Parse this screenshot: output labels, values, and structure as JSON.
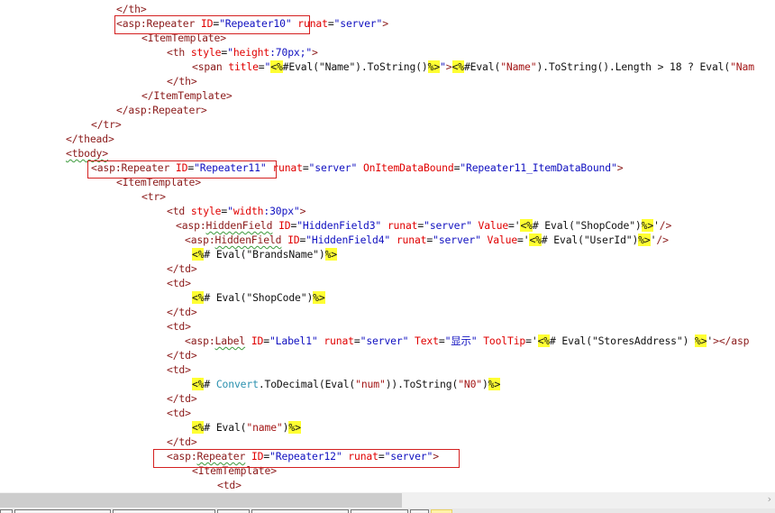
{
  "editor": {
    "lines": [
      [
        [
          "t",
          "</th>"
        ]
      ],
      [
        [
          "t",
          "<asp:Repeater "
        ],
        [
          "a",
          "ID"
        ],
        [
          "c",
          "="
        ],
        [
          "v",
          "\"Repeater10\""
        ],
        [
          "c",
          " "
        ],
        [
          "a",
          "runat"
        ],
        [
          "c",
          "="
        ],
        [
          "v",
          "\"server\""
        ],
        [
          "t",
          ">"
        ]
      ],
      [
        [
          "t",
          "<ItemTemplate>"
        ]
      ],
      [
        [
          "t",
          "<th "
        ],
        [
          "a",
          "style"
        ],
        [
          "c",
          "="
        ],
        [
          "v",
          "\""
        ],
        [
          "a",
          "height"
        ],
        [
          "v",
          ":70px;\""
        ],
        [
          "t",
          ">"
        ]
      ],
      [
        [
          "t",
          "<span "
        ],
        [
          "a",
          "title"
        ],
        [
          "c",
          "="
        ],
        [
          "v",
          "\""
        ],
        [
          "h",
          "<%"
        ],
        [
          "c",
          "#Eval(\"Name\").ToString()"
        ],
        [
          "h",
          "%>"
        ],
        [
          "v",
          "\""
        ],
        [
          "t",
          ">"
        ],
        [
          "h",
          "<%"
        ],
        [
          "c",
          "#Eval("
        ],
        [
          "s",
          "\"Name\""
        ],
        [
          "c",
          ").ToString().Length > 18 ? Eval("
        ],
        [
          "s",
          "\"Nam"
        ]
      ],
      [
        [
          "t",
          "</th>"
        ]
      ],
      [
        [
          "t",
          "</ItemTemplate>"
        ]
      ],
      [
        [
          "t",
          "</asp:Repeater>"
        ]
      ],
      [
        [
          "t",
          "</tr>"
        ]
      ],
      [
        [
          "t",
          "</thead>"
        ]
      ],
      [
        [
          "sq",
          "<tbody>"
        ]
      ],
      [
        [
          "t",
          "<asp:Repeater "
        ],
        [
          "a",
          "ID"
        ],
        [
          "c",
          "="
        ],
        [
          "v",
          "\"Repeater11\""
        ],
        [
          "c",
          " "
        ],
        [
          "a",
          "runat"
        ],
        [
          "c",
          "="
        ],
        [
          "v",
          "\"server\""
        ],
        [
          "c",
          " "
        ],
        [
          "a",
          "OnItemDataBound"
        ],
        [
          "c",
          "="
        ],
        [
          "v",
          "\"Repeater11_ItemDataBound\""
        ],
        [
          "t",
          ">"
        ]
      ],
      [
        [
          "t",
          "<ItemTemplate>"
        ]
      ],
      [
        [
          "t",
          "<tr>"
        ]
      ],
      [
        [
          "t",
          "<td "
        ],
        [
          "a",
          "style"
        ],
        [
          "c",
          "="
        ],
        [
          "v",
          "\""
        ],
        [
          "a",
          "width"
        ],
        [
          "v",
          ":30px\""
        ],
        [
          "t",
          ">"
        ]
      ],
      [
        [
          "t",
          "<asp:"
        ],
        [
          "sq",
          "HiddenField"
        ],
        [
          "t",
          " "
        ],
        [
          "a",
          "ID"
        ],
        [
          "c",
          "="
        ],
        [
          "v",
          "\"HiddenField3\""
        ],
        [
          "c",
          " "
        ],
        [
          "a",
          "runat"
        ],
        [
          "c",
          "="
        ],
        [
          "v",
          "\"server\""
        ],
        [
          "c",
          " "
        ],
        [
          "a",
          "Value"
        ],
        [
          "c",
          "='"
        ],
        [
          "h",
          "<%"
        ],
        [
          "c",
          "# Eval(\"ShopCode\")"
        ],
        [
          "h",
          "%>"
        ],
        [
          "c",
          "'"
        ],
        [
          "t",
          "/>"
        ]
      ],
      [
        [
          "t",
          "<asp:"
        ],
        [
          "sq",
          "HiddenField"
        ],
        [
          "t",
          " "
        ],
        [
          "a",
          "ID"
        ],
        [
          "c",
          "="
        ],
        [
          "v",
          "\"HiddenField4\""
        ],
        [
          "c",
          " "
        ],
        [
          "a",
          "runat"
        ],
        [
          "c",
          "="
        ],
        [
          "v",
          "\"server\""
        ],
        [
          "c",
          " "
        ],
        [
          "a",
          "Value"
        ],
        [
          "c",
          "='"
        ],
        [
          "h",
          "<%"
        ],
        [
          "c",
          "# Eval(\"UserId\")"
        ],
        [
          "h",
          "%>"
        ],
        [
          "c",
          "'"
        ],
        [
          "t",
          "/>"
        ]
      ],
      [
        [
          "h",
          "<%"
        ],
        [
          "c",
          "# Eval(\"BrandsName\")"
        ],
        [
          "h",
          "%>"
        ]
      ],
      [
        [
          "t",
          "</td>"
        ]
      ],
      [
        [
          "t",
          "<td>"
        ]
      ],
      [
        [
          "h",
          "<%"
        ],
        [
          "c",
          "# Eval(\"ShopCode\")"
        ],
        [
          "h",
          "%>"
        ]
      ],
      [
        [
          "t",
          "</td>"
        ]
      ],
      [
        [
          "t",
          "<td>"
        ]
      ],
      [
        [
          "t",
          "<asp:"
        ],
        [
          "sq",
          "Label"
        ],
        [
          "t",
          " "
        ],
        [
          "a",
          "ID"
        ],
        [
          "c",
          "="
        ],
        [
          "v",
          "\"Label1\""
        ],
        [
          "c",
          " "
        ],
        [
          "a",
          "runat"
        ],
        [
          "c",
          "="
        ],
        [
          "v",
          "\"server\""
        ],
        [
          "c",
          " "
        ],
        [
          "a",
          "Text"
        ],
        [
          "c",
          "="
        ],
        [
          "v",
          "\"显示\""
        ],
        [
          "c",
          " "
        ],
        [
          "a",
          "ToolTip"
        ],
        [
          "c",
          "='"
        ],
        [
          "h",
          "<%"
        ],
        [
          "c",
          "# Eval(\"StoresAddress\") "
        ],
        [
          "h",
          "%>"
        ],
        [
          "c",
          "'"
        ],
        [
          "t",
          "></asp"
        ]
      ],
      [
        [
          "t",
          "</td>"
        ]
      ],
      [
        [
          "t",
          "<td>"
        ]
      ],
      [
        [
          "h",
          "<%"
        ],
        [
          "c",
          "# "
        ],
        [
          "k",
          "Convert"
        ],
        [
          "c",
          ".ToDecimal(Eval("
        ],
        [
          "s",
          "\"num\""
        ],
        [
          "c",
          ")).ToString("
        ],
        [
          "s",
          "\"N0\""
        ],
        [
          "c",
          ")"
        ],
        [
          "h",
          "%>"
        ]
      ],
      [
        [
          "t",
          "</td>"
        ]
      ],
      [
        [
          "t",
          "<td>"
        ]
      ],
      [
        [
          "h",
          "<%"
        ],
        [
          "c",
          "# Eval("
        ],
        [
          "s",
          "\"name\""
        ],
        [
          "c",
          ")"
        ],
        [
          "h",
          "%>"
        ]
      ],
      [
        [
          "t",
          "</td>"
        ]
      ],
      [
        [
          "t",
          "<asp:"
        ],
        [
          "sq",
          "Repeater"
        ],
        [
          "t",
          " "
        ],
        [
          "a",
          "ID"
        ],
        [
          "c",
          "="
        ],
        [
          "v",
          "\"Repeater12\""
        ],
        [
          "c",
          " "
        ],
        [
          "a",
          "runat"
        ],
        [
          "c",
          "="
        ],
        [
          "v",
          "\"server\""
        ],
        [
          "t",
          ">"
        ]
      ],
      [
        [
          "t",
          "<ItemTemplate>"
        ]
      ],
      [
        [
          "t",
          "<td>"
        ]
      ]
    ]
  },
  "scrollbar": {
    "right_arrow": "›",
    "position_fraction": 0.0,
    "visible_fraction": 0.52
  }
}
